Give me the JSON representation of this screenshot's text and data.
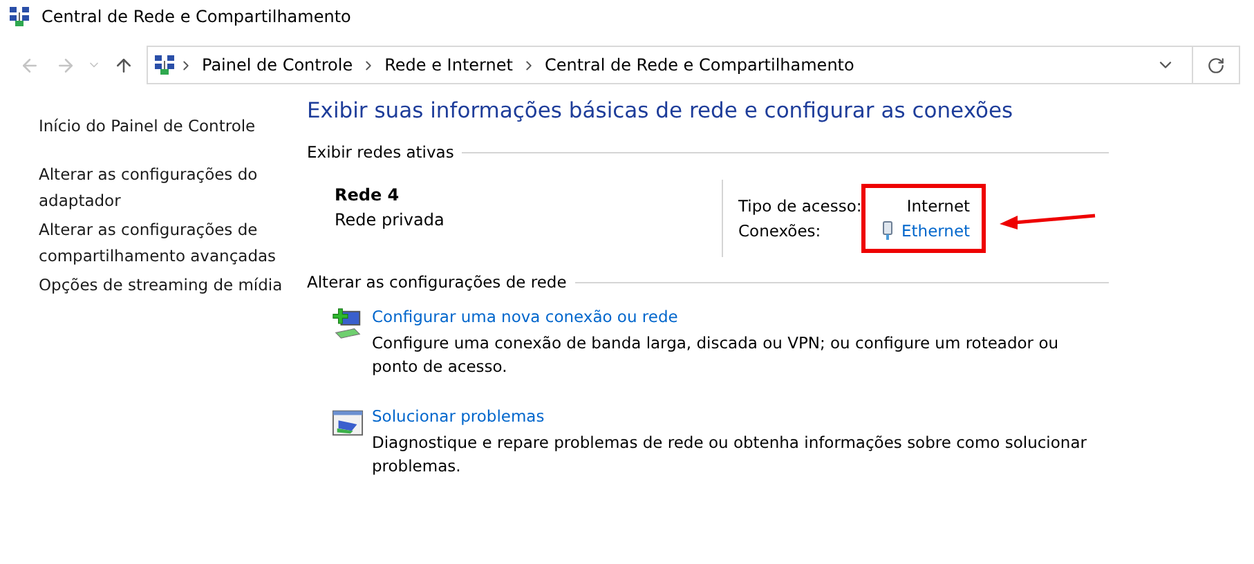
{
  "window": {
    "title": "Central de Rede e Compartilhamento"
  },
  "address_bar": {
    "crumbs": [
      "Painel de Controle",
      "Rede e Internet",
      "Central de Rede e Compartilhamento"
    ]
  },
  "sidebar": {
    "links": [
      "Início do Painel de Controle",
      "Alterar as configurações do adaptador",
      "Alterar as configurações de compartilhamento avançadas",
      "Opções de streaming de mídia"
    ]
  },
  "heading": "Exibir suas informações básicas de rede e configurar as conexões",
  "active_networks": {
    "label": "Exibir redes ativas",
    "networks": [
      {
        "name": "Rede 4",
        "category": "Rede privada",
        "access_type_label": "Tipo de acesso:",
        "access_type": "Internet",
        "connections_label": "Conexões:",
        "connection": "Ethernet",
        "highlighted": true
      }
    ]
  },
  "change_settings": {
    "label": "Alterar as configurações de rede",
    "tasks": [
      {
        "kind": "new_connection",
        "title": "Configurar uma nova conexão ou rede",
        "description": "Configure uma conexão de banda larga, discada ou VPN; ou configure um roteador ou ponto de acesso."
      },
      {
        "kind": "troubleshoot",
        "title": "Solucionar problemas",
        "description": "Diagnostique e repare problemas de rede ou obtenha informações sobre como solucionar problemas."
      }
    ]
  }
}
